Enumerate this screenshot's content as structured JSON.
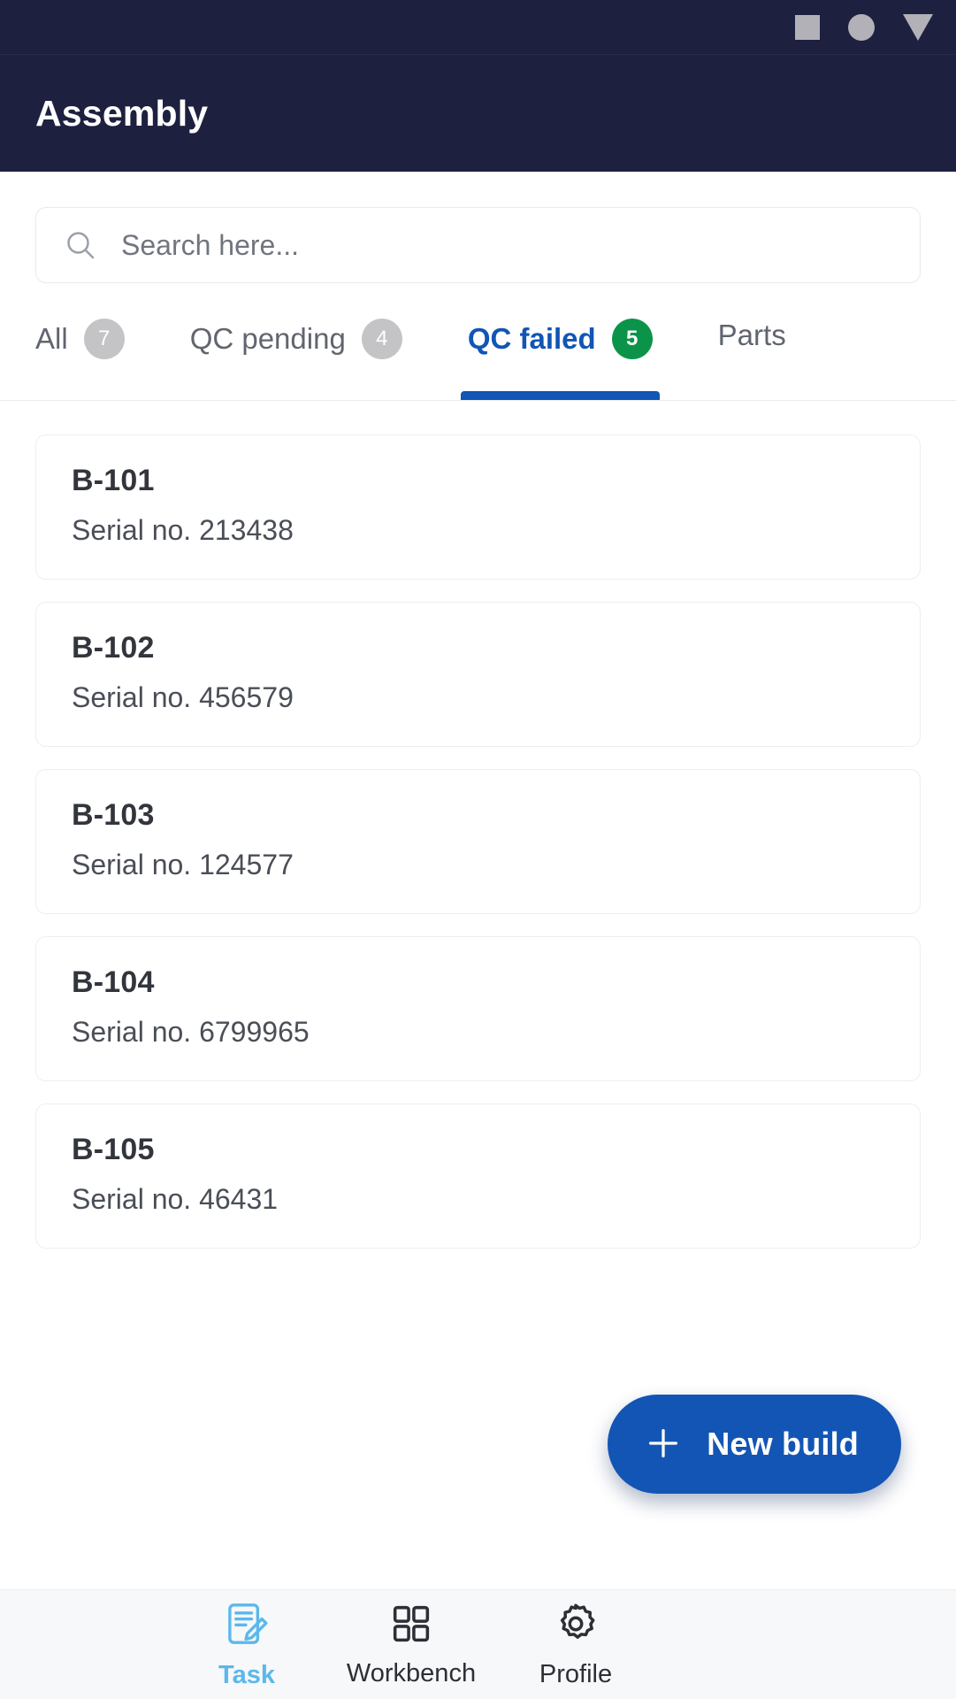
{
  "statusbar": {
    "icons": [
      "square-nav-icon",
      "circle-nav-icon",
      "triangle-nav-icon"
    ]
  },
  "appbar": {
    "title": "Assembly"
  },
  "search": {
    "placeholder": "Search here...",
    "value": "",
    "icon": "search-icon"
  },
  "tabs": {
    "items": [
      {
        "label": "All",
        "badge": "7",
        "active": false
      },
      {
        "label": "QC pending",
        "badge": "4",
        "active": false
      },
      {
        "label": "QC failed",
        "badge": "5",
        "active": true
      },
      {
        "label": "Parts",
        "badge": "",
        "active": false
      }
    ],
    "active_index": 2
  },
  "list": {
    "items": [
      {
        "title": "B-101",
        "subtitle": "Serial no. 213438"
      },
      {
        "title": "B-102",
        "subtitle": "Serial no. 456579"
      },
      {
        "title": "B-103",
        "subtitle": "Serial no. 124577"
      },
      {
        "title": "B-104",
        "subtitle": "Serial no. 6799965"
      },
      {
        "title": "B-105",
        "subtitle": "Serial no. 46431"
      }
    ]
  },
  "fab": {
    "label": "New build",
    "icon": "plus-icon"
  },
  "bottomnav": {
    "items": [
      {
        "label": "Task",
        "icon": "task-document-pencil-icon",
        "active": true
      },
      {
        "label": "Workbench",
        "icon": "grid-squares-icon",
        "active": false
      },
      {
        "label": "Profile",
        "icon": "gear-icon",
        "active": false
      }
    ]
  },
  "colors": {
    "header_bg": "#1e2040",
    "accent_blue": "#1155b5",
    "badge_green": "#0b9449",
    "nav_active": "#5bb8ec",
    "sysnav_gray": "#b3b1b8"
  }
}
